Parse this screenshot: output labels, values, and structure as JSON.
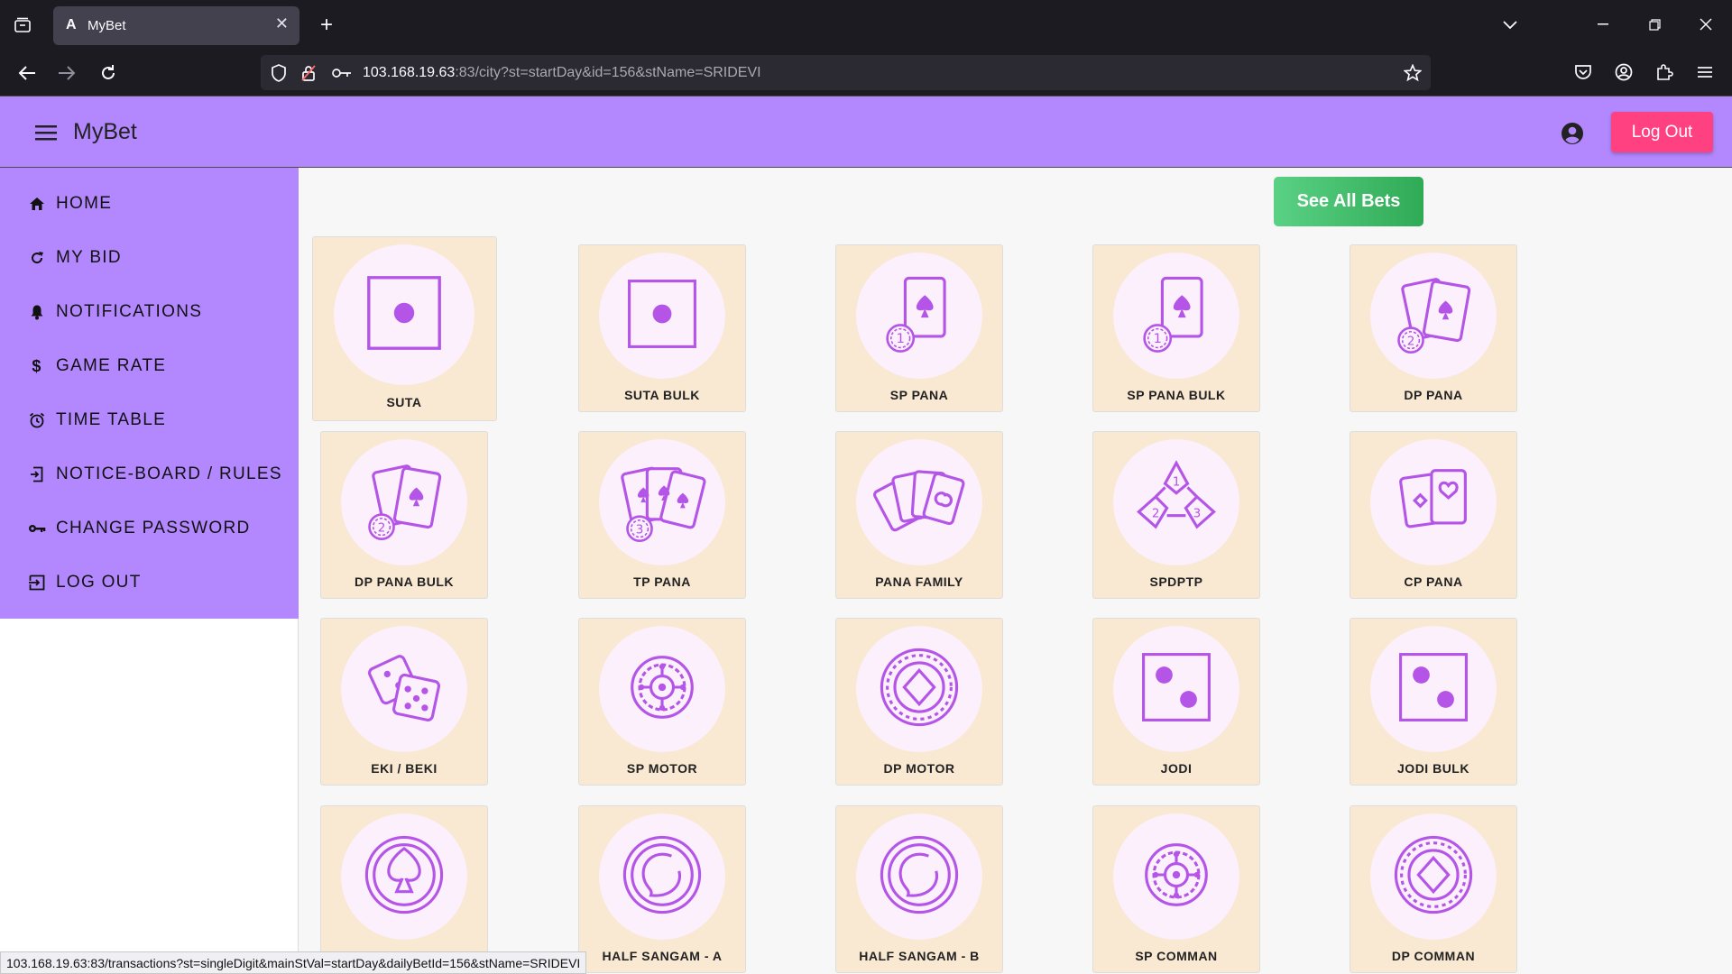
{
  "browser": {
    "tab_title": "MyBet",
    "tab_favicon": "A",
    "url_host": "103.168.19.63",
    "url_rest": ":83/city?st=startDay&id=156&stName=SRIDEVI",
    "status_url": "103.168.19.63:83/transactions?st=singleDigit&mainStVal=startDay&dailyBetId=156&stName=SRIDEVI"
  },
  "header": {
    "title": "MyBet",
    "logout_label": "Log Out"
  },
  "sidebar": {
    "items": [
      {
        "label": "HOME",
        "icon": "home-icon"
      },
      {
        "label": "MY BID",
        "icon": "refresh-icon"
      },
      {
        "label": "NOTIFICATIONS",
        "icon": "bell-icon"
      },
      {
        "label": "GAME RATE",
        "icon": "dollar-icon"
      },
      {
        "label": "TIME TABLE",
        "icon": "alarm-icon"
      },
      {
        "label": "NOTICE-BOARD / RULES",
        "icon": "notice-icon"
      },
      {
        "label": "CHANGE PASSWORD",
        "icon": "key-icon"
      },
      {
        "label": "LOG OUT",
        "icon": "logout-icon"
      }
    ]
  },
  "see_all_label": "See All Bets",
  "games": [
    {
      "label": "SUTA",
      "icon": "single-dot-icon"
    },
    {
      "label": "SUTA BULK",
      "icon": "single-dot-icon"
    },
    {
      "label": "SP PANA",
      "icon": "card-chip-1-icon"
    },
    {
      "label": "SP PANA BULK",
      "icon": "card-chip-1-icon"
    },
    {
      "label": "DP PANA",
      "icon": "two-cards-chip-2-icon"
    },
    {
      "label": "DP PANA BULK",
      "icon": "two-cards-chip-2-icon"
    },
    {
      "label": "TP PANA",
      "icon": "three-cards-chip-3-icon"
    },
    {
      "label": "PANA FAMILY",
      "icon": "card-fan-icon"
    },
    {
      "label": "SPDPTP",
      "icon": "triangle-123-icon"
    },
    {
      "label": "CP PANA",
      "icon": "cards-heart-icon"
    },
    {
      "label": "EKI / BEKI",
      "icon": "dice-icon"
    },
    {
      "label": "SP MOTOR",
      "icon": "roulette-icon"
    },
    {
      "label": "DP MOTOR",
      "icon": "diamond-chip-icon"
    },
    {
      "label": "JODI",
      "icon": "two-dots-icon"
    },
    {
      "label": "JODI BULK",
      "icon": "two-dots-icon"
    },
    {
      "label": "",
      "icon": "spade-chip-icon"
    },
    {
      "label": "HALF SANGAM - A",
      "icon": "swirl-chip-icon"
    },
    {
      "label": "HALF SANGAM - B",
      "icon": "swirl-chip-icon"
    },
    {
      "label": "SP COMMAN",
      "icon": "roulette-icon"
    },
    {
      "label": "DP COMMAN",
      "icon": "diamond-chip-icon"
    }
  ],
  "colors": {
    "header": "#b388ff",
    "accent": "#ff4081",
    "icon": "#b455e8",
    "card": "#f9e8d2",
    "green": "#3cb962"
  }
}
